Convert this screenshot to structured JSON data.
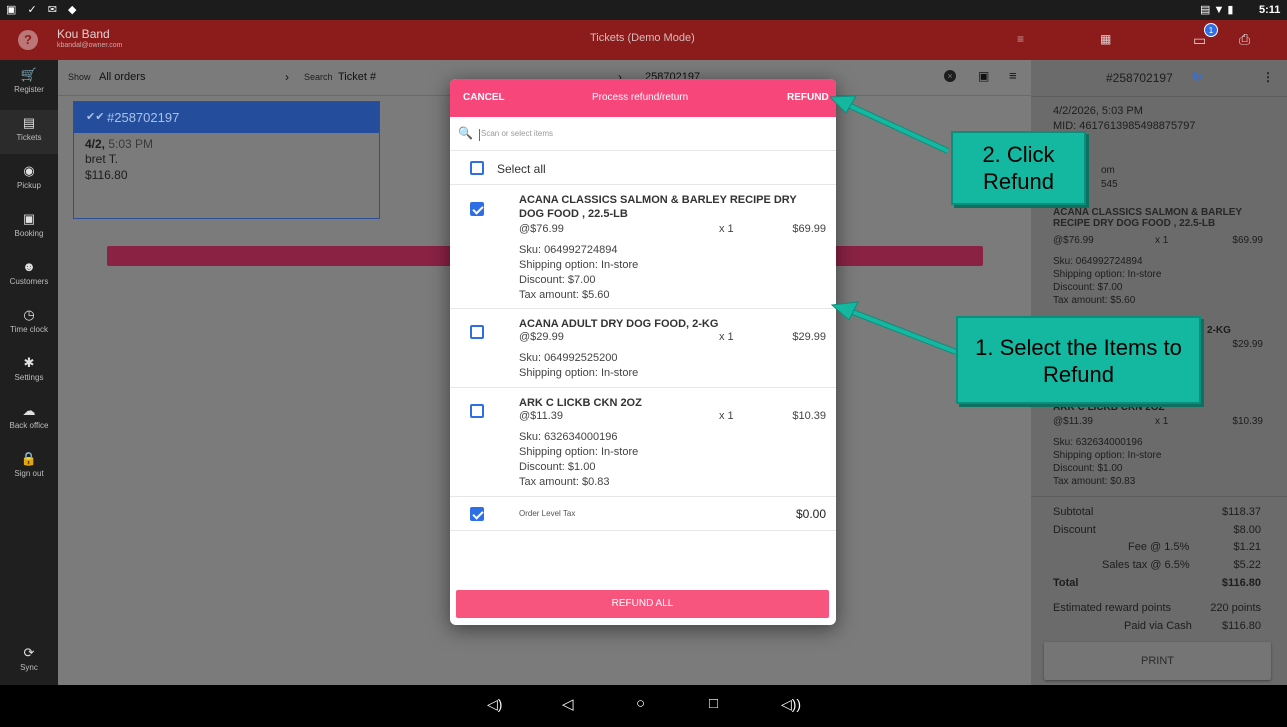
{
  "status": {
    "time": "5:11"
  },
  "top": {
    "user_name": "Kou Band",
    "user_email": "kbandal@owner.com",
    "title": "Tickets (Demo Mode)",
    "notif_count": "1"
  },
  "sidebar": {
    "items": [
      {
        "label": "Register",
        "icon": "cart-icon"
      },
      {
        "label": "Tickets",
        "icon": "ticket-icon"
      },
      {
        "label": "Pickup",
        "icon": "pickup-icon"
      },
      {
        "label": "Booking",
        "icon": "calendar-icon"
      },
      {
        "label": "Customers",
        "icon": "people-icon"
      },
      {
        "label": "Time clock",
        "icon": "clock-icon"
      },
      {
        "label": "Settings",
        "icon": "gear-icon"
      },
      {
        "label": "Back office",
        "icon": "cloud-icon"
      },
      {
        "label": "Sign out",
        "icon": "lock-icon"
      },
      {
        "label": "Sync",
        "icon": "sync-icon"
      }
    ]
  },
  "filter": {
    "show_label": "Show",
    "show_value": "All orders",
    "search_label": "Search",
    "search_field": "Ticket #",
    "search_value": "258702197"
  },
  "ticket": {
    "number": "#258702197",
    "date": "4/2,",
    "time": "5:03 PM",
    "customer": "bret T.",
    "total": "$116.80"
  },
  "modal": {
    "cancel": "CANCEL",
    "title": "Process refund/return",
    "refund": "REFUND",
    "search_placeholder": "Scan or select items",
    "select_all": "Select all",
    "refund_all": "REFUND ALL",
    "items": [
      {
        "name": "ACANA CLASSICS SALMON & BARLEY RECIPE DRY DOG FOOD , 22.5-LB",
        "price": "@$76.99",
        "qty": "x  1",
        "amount": "$69.99",
        "details": [
          "Sku: 064992724894",
          "Shipping option: In-store",
          "Discount: $7.00",
          "Tax amount: $5.60"
        ],
        "checked": true
      },
      {
        "name": "ACANA ADULT DRY DOG FOOD, 2-KG",
        "price": "@$29.99",
        "qty": "x  1",
        "amount": "$29.99",
        "details": [
          "Sku: 064992525200",
          "Shipping option: In-store"
        ],
        "checked": false
      },
      {
        "name": "ARK C LICKB CKN 2OZ",
        "price": "@$11.39",
        "qty": "x  1",
        "amount": "$10.39",
        "details": [
          "Sku: 632634000196",
          "Shipping option: In-store",
          "Discount: $1.00",
          "Tax amount: $0.83"
        ],
        "checked": false
      }
    ],
    "order_tax": {
      "label": "Order Level Tax",
      "amount": "$0.00",
      "checked": true
    }
  },
  "right": {
    "ticket": "#258702197",
    "date": "4/2/2026, 5:03 PM",
    "mid": "MID: 4617613985498875797",
    "email_frag": "om",
    "phone_frag": "545",
    "item1": {
      "name": "ACANA CLASSICS SALMON & BARLEY RECIPE DRY DOG FOOD  , 22.5-LB",
      "price": "@$76.99",
      "qty": "x  1",
      "amount": "$69.99",
      "details": [
        "Sku: 064992724894",
        "Shipping option: In-store",
        "Discount: $7.00",
        "Tax amount: $5.60"
      ]
    },
    "item2": {
      "name_frag": "2-KG",
      "amount": "$29.99"
    },
    "item3": {
      "name": "ARK C LICKB CKN 2OZ",
      "price": "@$11.39",
      "qty": "x  1",
      "amount": "$10.39",
      "details": [
        "Sku: 632634000196",
        "Shipping option: In-store",
        "Discount: $1.00",
        "Tax amount: $0.83"
      ]
    },
    "totals": [
      {
        "label": "Subtotal",
        "value": "$118.37"
      },
      {
        "label": "Discount",
        "value": "$8.00"
      },
      {
        "label": "Fee @ 1.5%",
        "value": "$1.21"
      },
      {
        "label": "Sales tax @ 6.5%",
        "value": "$5.22"
      },
      {
        "label": "Total",
        "value": "$116.80"
      },
      {
        "label": "Estimated reward points",
        "value": "220 points"
      },
      {
        "label": "Paid via Cash",
        "value": "$116.80"
      }
    ],
    "print": "PRINT"
  },
  "callouts": {
    "step2": "2. Click Refund",
    "step1": "1. Select the Items to Refund"
  },
  "colors": {
    "accent": "#f7467a",
    "topbar": "#8c1c1c",
    "callout": "#14b8a0",
    "checkbox": "#2f6fe6",
    "ticket_header": "#2c5fc4"
  }
}
